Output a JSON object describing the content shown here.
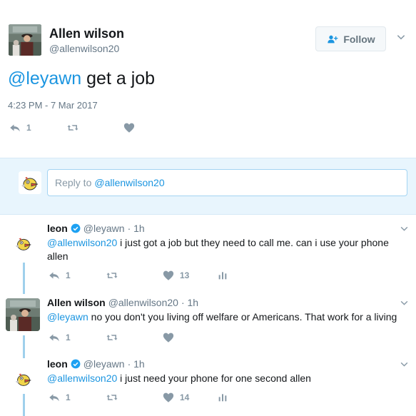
{
  "main_tweet": {
    "author_name": "Allen wilson",
    "author_handle": "@allenwilson20",
    "follow_label": "Follow",
    "text_mention": "@leyawn",
    "text_body": " get a job",
    "timestamp": "4:23 PM - 7 Mar 2017",
    "reply_count": "1",
    "retweet_count": "",
    "like_count": ""
  },
  "reply_box": {
    "prefix": "Reply to",
    "mention": "@allenwilson20"
  },
  "replies": [
    {
      "author_name": "leon",
      "author_handle": "@leyawn",
      "time": "· 1h",
      "mention": "@allenwilson20",
      "body": " i just got a job but they need to call me. can i use your phone allen",
      "reply_count": "1",
      "retweet_count": "",
      "like_count": "13"
    },
    {
      "author_name": "Allen wilson",
      "author_handle": "@allenwilson20",
      "time": "· 1h",
      "mention": "@leyawn",
      "body": " no you don't you living off welfare or Americans. That work for a living",
      "reply_count": "1",
      "retweet_count": "",
      "like_count": ""
    },
    {
      "author_name": "leon",
      "author_handle": "@leyawn",
      "time": "· 1h",
      "mention": "@allenwilson20",
      "body": " i just need your phone for one second allen",
      "reply_count": "1",
      "retweet_count": "",
      "like_count": "14"
    }
  ],
  "colors": {
    "link": "#1b95e0",
    "muted": "#657786",
    "icon": "#8899a6",
    "reply_bg": "#e8f5fd",
    "thread": "#9fd0ec",
    "verified": "#1da1f2"
  },
  "icons": [
    "reply-icon",
    "retweet-icon",
    "like-icon",
    "analytics-icon",
    "chevron-down-icon",
    "add-user-icon",
    "verified-icon"
  ]
}
